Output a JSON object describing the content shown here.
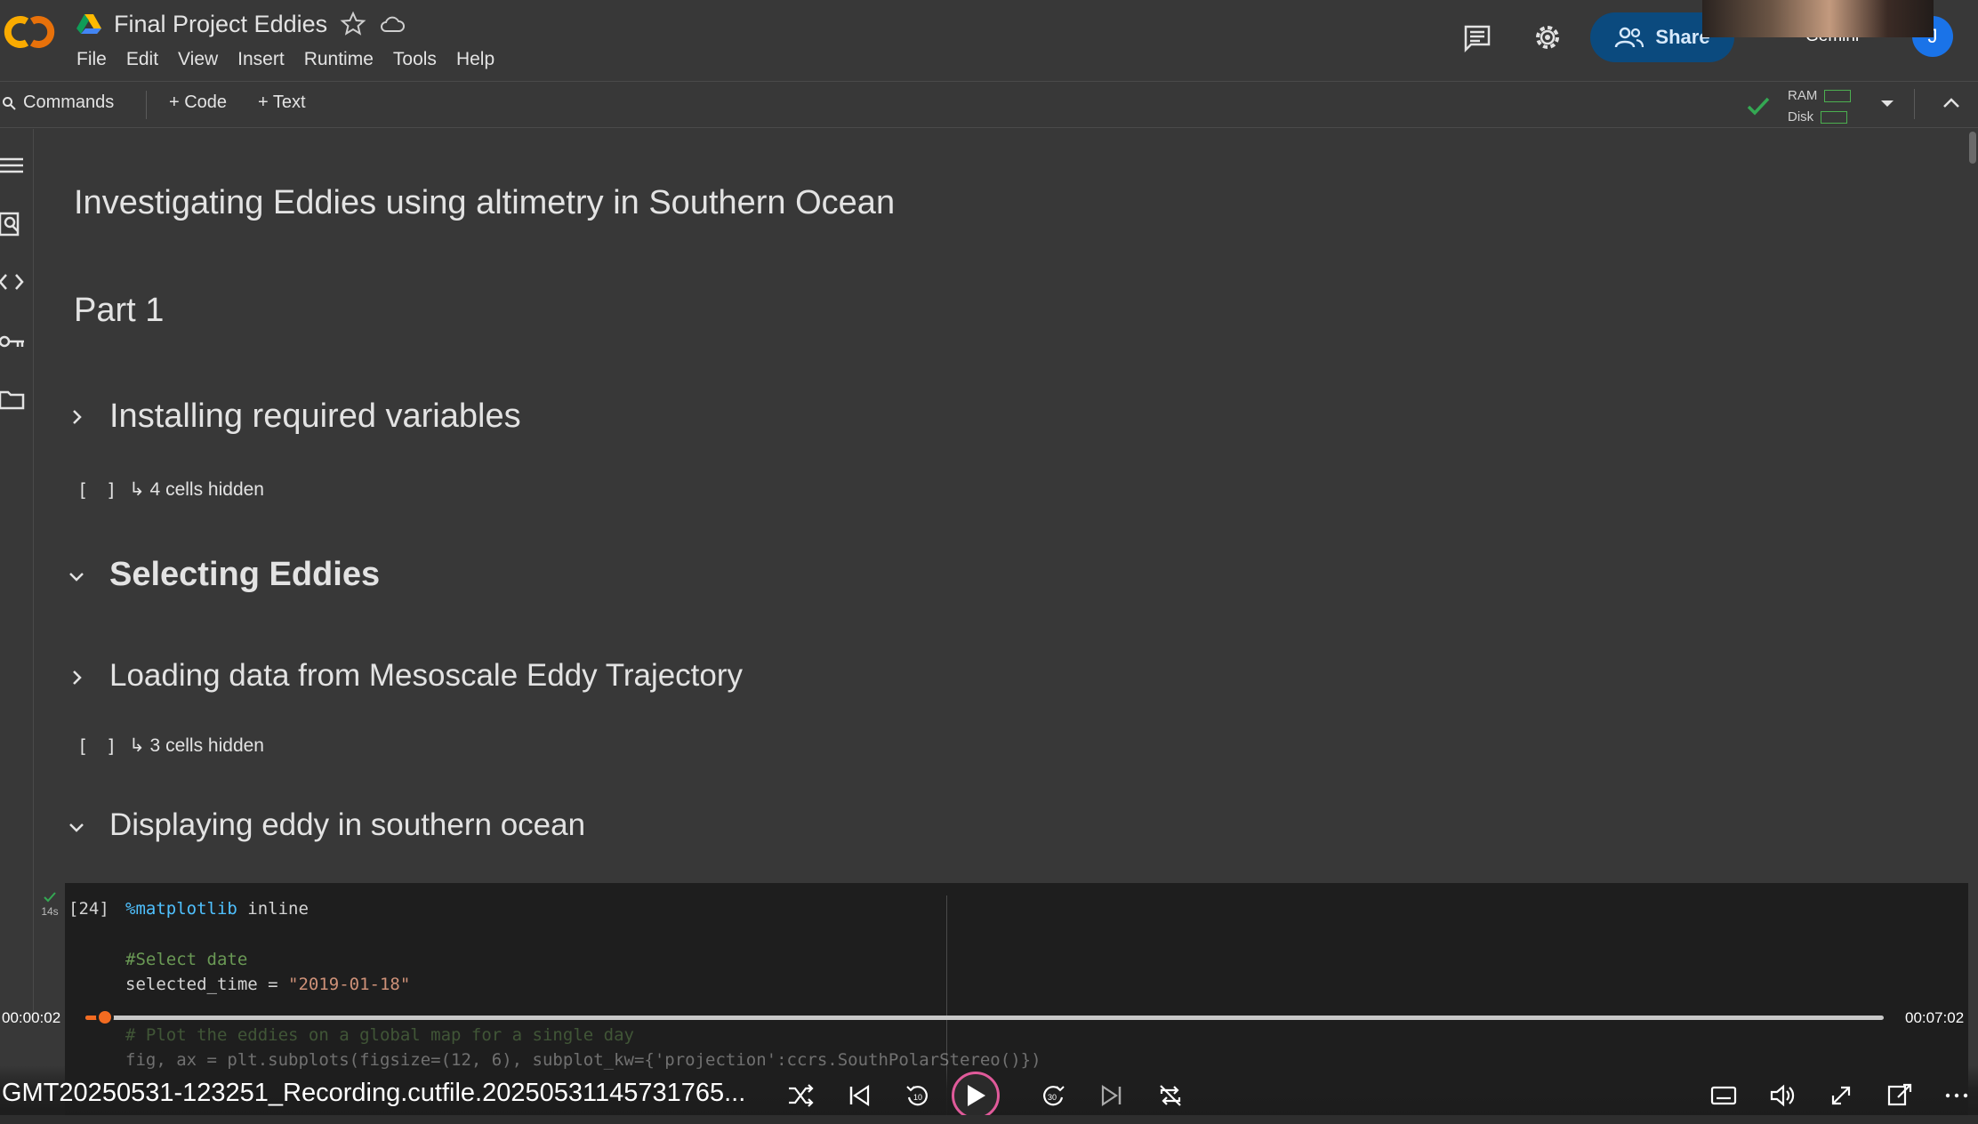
{
  "header": {
    "logo_text": "CO",
    "doc_title": "Final Project Eddies",
    "menu": [
      "File",
      "Edit",
      "View",
      "Insert",
      "Runtime",
      "Tools",
      "Help"
    ],
    "share_label": "Share",
    "gemini_label": "Gemini",
    "avatar_initial": "J"
  },
  "toolbar": {
    "commands_label": "Commands",
    "add_code_label": "+ Code",
    "add_text_label": "+ Text",
    "ram_label": "RAM",
    "disk_label": "Disk"
  },
  "notebook": {
    "title": "Investigating Eddies using altimetry in Southern Ocean",
    "part": "Part 1",
    "sections": [
      {
        "title": "Installing required variables",
        "collapsed": true
      },
      {
        "title": "Selecting Eddies",
        "collapsed": false
      },
      {
        "title": "Loading data from Mesoscale Eddy Trajectory",
        "collapsed": true
      },
      {
        "title": "Displaying eddy in southern ocean",
        "collapsed": false
      }
    ],
    "hidden_1": "↳ 4 cells hidden",
    "hidden_2": "↳ 3 cells hidden",
    "hidden_brackets": "[ ]",
    "cell": {
      "exec_count": "[24]",
      "duration": "14s",
      "lines": {
        "magic": "%matplotlib",
        "magic_rest": " inline",
        "comment_date": "#Select date",
        "assign_lhs": "selected_time = ",
        "assign_rhs": "\"2019-01-18\"",
        "comment_plot": "# Plot the eddies on a global map for a single day",
        "fig_line": "fig, ax = plt.subplots(figsize=(12, 6), subplot_kw={'projection':ccrs.SouthPolarStereo()})"
      }
    }
  },
  "player": {
    "time_current": "00:00:02",
    "time_total": "00:07:02",
    "progress": 0.0047,
    "file_name": "GMT20250531-123251_Recording.cutfile.20250531145731765...",
    "accent_color": "#f26b21"
  }
}
